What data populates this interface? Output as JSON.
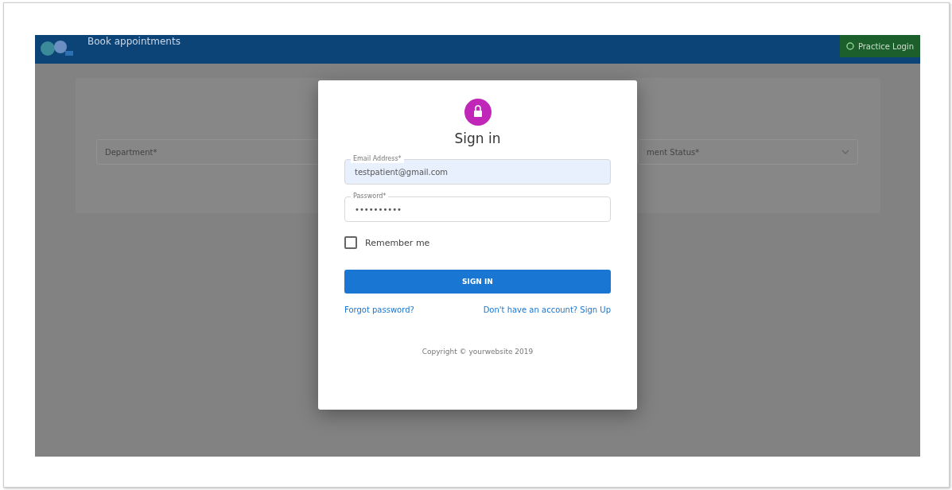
{
  "header": {
    "title": "Book appointments",
    "login_button": "Practice Login"
  },
  "filters": [
    {
      "label": "Department*",
      "has_arrow": false
    },
    {
      "label": "ment Status*",
      "has_arrow": true
    }
  ],
  "dialog": {
    "title": "Sign in",
    "fields": [
      {
        "label": "Email Address*",
        "value": "testpatient@gmail.com",
        "autofilled": true
      },
      {
        "label": "Password*",
        "value": "••••••••••",
        "autofilled": false
      }
    ],
    "remember": {
      "label": "Remember me",
      "checked": false
    },
    "submit": "SIGN IN",
    "forgot_link": "Forgot password?",
    "signup_link": "Don't have an account? Sign Up",
    "copyright": "Copyright © yourwebsite 2019"
  }
}
